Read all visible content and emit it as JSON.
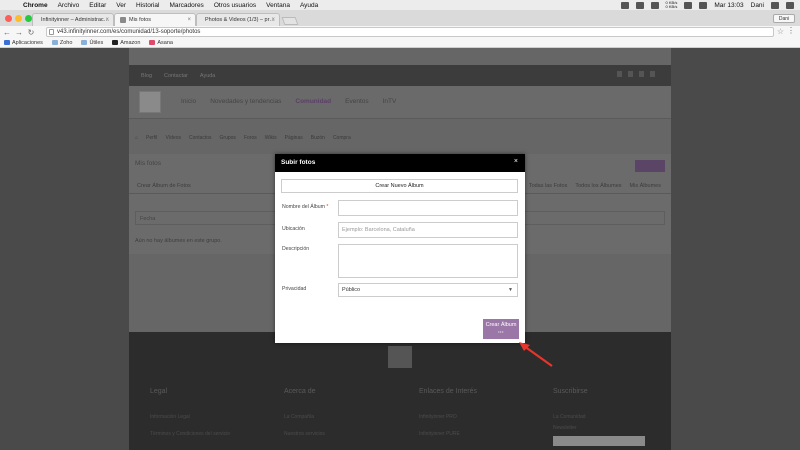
{
  "menubar": {
    "app": "Chrome",
    "items": [
      "Archivo",
      "Editar",
      "Ver",
      "Historial",
      "Marcadores",
      "Otros usuarios",
      "Ventana",
      "Ayuda"
    ],
    "clock": "Mar 13:03",
    "user": "Dani",
    "net_up": "0 KB/s",
    "net_down": "0 KB/s"
  },
  "tabs": [
    {
      "label": "Infinityinner – Administrac…",
      "color": "#e07a3a"
    },
    {
      "label": "Mis fotos",
      "color": "#8a8a8a"
    },
    {
      "label": "Photos & Videos (1/3) – pr…",
      "color": "#3a9a4a"
    }
  ],
  "profile_button": "Dani",
  "address": {
    "url": "v43.infinityinner.com/es/comunidad/13-soporte/photos"
  },
  "bookmarks": [
    {
      "label": "Aplicaciones",
      "color": "#3a6fd8"
    },
    {
      "label": "Zoho",
      "color": "#8ab0d8"
    },
    {
      "label": "Útiles",
      "color": "#8ab0d8"
    },
    {
      "label": "Amazon",
      "color": "#222222"
    },
    {
      "label": "Asana",
      "color": "#e04a6a"
    }
  ],
  "site": {
    "topstrip": [
      "Blog",
      "Contactar",
      "Ayuda"
    ],
    "nav": [
      "Inicio",
      "Novedades y tendencias",
      "Comunidad",
      "Eventos",
      "InTV"
    ],
    "subnav": [
      "Perfil",
      "Vídeos",
      "Contactos",
      "Grupos",
      "Foros",
      "Wikis",
      "Páginas",
      "Buzón",
      "Compra"
    ],
    "panel_title": "Mis fotos",
    "panel_button": "Subir fotos",
    "panel_tab_left": "Crear Álbum de Fotos",
    "panel_tabs_right": [
      "Todas las Fotos",
      "Todos los Álbumes",
      "Mis Álbumes"
    ],
    "panel_input": "Fecha",
    "panel_empty": "Aún no hay álbumes en este grupo.",
    "footer_cols": [
      {
        "title": "Legal",
        "links": [
          "Información Legal",
          "Términos y Condiciones del servicio"
        ]
      },
      {
        "title": "Acerca de",
        "links": [
          "La Compañía",
          "Nuestros servicios"
        ]
      },
      {
        "title": "Enlaces de Interés",
        "links": [
          "Infinityinner PRO",
          "Infinityinner PURE"
        ]
      },
      {
        "title": "Suscribirse",
        "links": [
          "La Comunidad",
          "Newsletter"
        ]
      }
    ]
  },
  "modal": {
    "title": "Subir fotos",
    "close": "×",
    "create_album": "Crear Nuevo Álbum",
    "album_name_label": "Nombre del Álbum",
    "required_mark": "*",
    "location_label": "Ubicación",
    "location_placeholder": "Ejemplo: Barcelona, Cataluña",
    "description_label": "Descripción",
    "privacy_label": "Privacidad",
    "privacy_value": "Público",
    "submit": "Crear Álbum",
    "submit_dots": "•••"
  },
  "annotation": {
    "arrow_color": "#e8352b"
  }
}
